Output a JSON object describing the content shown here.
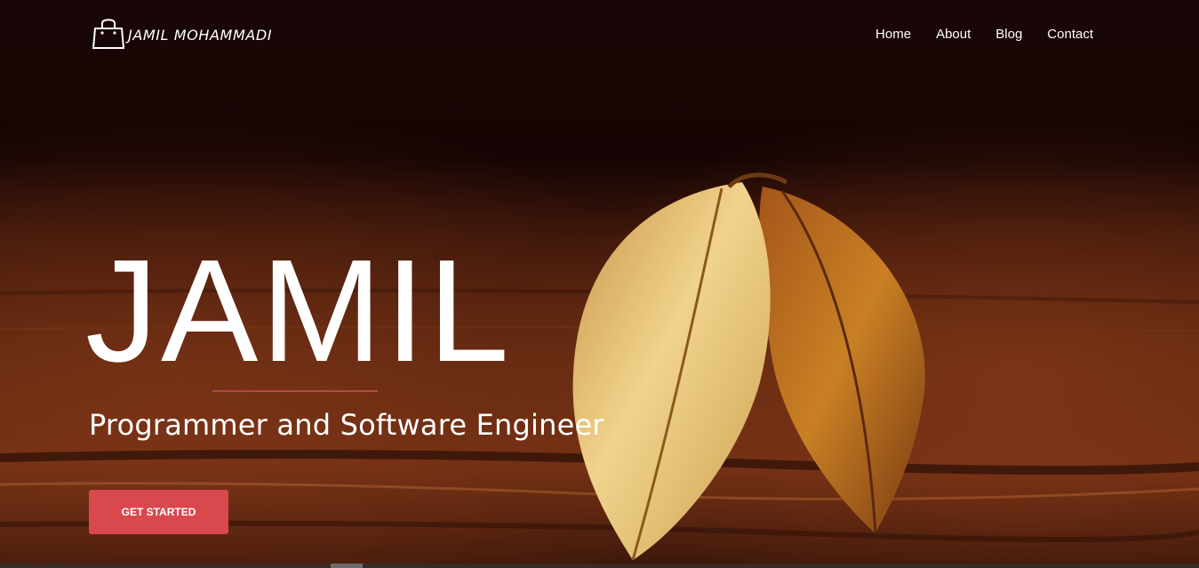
{
  "brand": {
    "name": "JAMIL MOHAMMADI",
    "icon": "shopping-bag-icon"
  },
  "nav": {
    "items": [
      {
        "label": "Home"
      },
      {
        "label": "About"
      },
      {
        "label": "Blog"
      },
      {
        "label": "Contact"
      }
    ]
  },
  "hero": {
    "title": "JAMIL",
    "subtitle": "Programmer and Software Engineer",
    "cta_label": "GET STARTED",
    "background": "leaves-on-wood-photo"
  },
  "colors": {
    "accent": "#d9484d",
    "divider": "#b2494a",
    "text": "#ffffff"
  }
}
